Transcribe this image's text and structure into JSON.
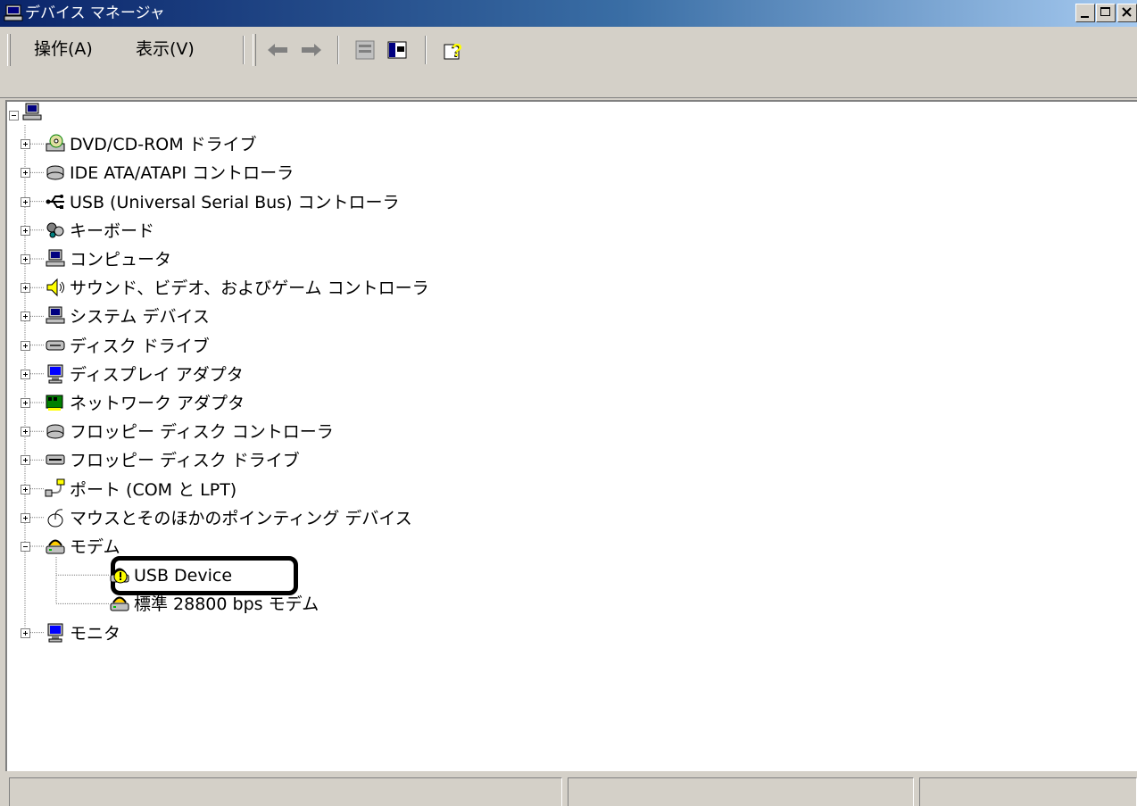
{
  "window": {
    "title": "デバイス マネージャ"
  },
  "caption_buttons": [
    "minimize",
    "maximize",
    "close"
  ],
  "menu": [
    {
      "label": "操作(A)"
    },
    {
      "label": "表示(V)"
    }
  ],
  "toolbar_icons": [
    "back-arrow-icon",
    "forward-arrow-icon",
    "properties-icon",
    "show-hide-console-tree-icon",
    "help-icon"
  ],
  "tree": {
    "root": {
      "icon": "computer-icon",
      "expanded": true
    },
    "categories": [
      {
        "label": "DVD/CD-ROM ドライブ",
        "icon": "cdrom-icon"
      },
      {
        "label": "IDE ATA/ATAPI コントローラ",
        "icon": "ide-controller-icon"
      },
      {
        "label": "USB (Universal Serial Bus) コントローラ",
        "icon": "usb-icon"
      },
      {
        "label": "キーボード",
        "icon": "keyboard-icon"
      },
      {
        "label": "コンピュータ",
        "icon": "computer-icon"
      },
      {
        "label": "サウンド、ビデオ、およびゲーム コントローラ",
        "icon": "speaker-icon"
      },
      {
        "label": "システム デバイス",
        "icon": "system-device-icon"
      },
      {
        "label": "ディスク ドライブ",
        "icon": "disk-drive-icon"
      },
      {
        "label": "ディスプレイ アダプタ",
        "icon": "display-adapter-icon"
      },
      {
        "label": "ネットワーク アダプタ",
        "icon": "network-adapter-icon"
      },
      {
        "label": "フロッピー ディスク コントローラ",
        "icon": "floppy-controller-icon"
      },
      {
        "label": "フロッピー ディスク ドライブ",
        "icon": "floppy-drive-icon"
      },
      {
        "label": "ポート (COM と LPT)",
        "icon": "port-icon"
      },
      {
        "label": "マウスとそのほかのポインティング デバイス",
        "icon": "mouse-icon"
      },
      {
        "label": "モデム",
        "icon": "modem-icon",
        "expanded": true,
        "children": [
          {
            "label": "USB Device",
            "icon": "modem-warning-icon",
            "highlighted": true
          },
          {
            "label": "標準 28800 bps モデム",
            "icon": "modem-icon"
          }
        ]
      },
      {
        "label": "モニタ",
        "icon": "monitor-icon"
      }
    ]
  },
  "statusbar": {
    "cells": [
      "",
      "",
      ""
    ]
  }
}
